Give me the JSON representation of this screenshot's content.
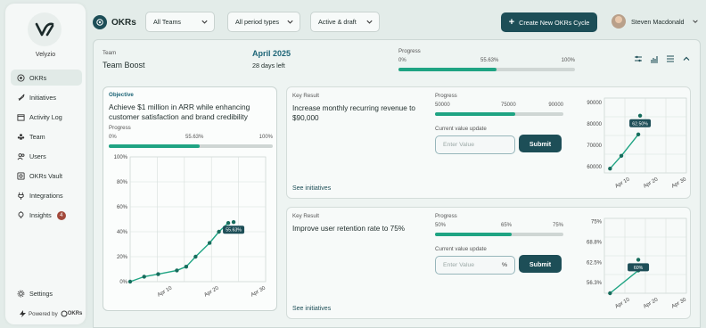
{
  "app": {
    "brand": "Velyzio",
    "powered_by": "Powered by",
    "powered_brand": "OKRs"
  },
  "sidebar": {
    "items": [
      {
        "label": "OKRs",
        "icon": "target-icon",
        "active": true
      },
      {
        "label": "Initiatives",
        "icon": "rocket-icon"
      },
      {
        "label": "Activity Log",
        "icon": "calendar-icon"
      },
      {
        "label": "Team",
        "icon": "team-icon"
      },
      {
        "label": "Users",
        "icon": "users-icon"
      },
      {
        "label": "OKRs Vault",
        "icon": "vault-icon"
      },
      {
        "label": "Integrations",
        "icon": "integrations-icon"
      },
      {
        "label": "Insights",
        "icon": "insights-icon",
        "badge": "4"
      }
    ],
    "settings_label": "Settings"
  },
  "topbar": {
    "title": "OKRs",
    "filters": {
      "team": "All Teams",
      "period": "All period types",
      "status": "Active & draft"
    },
    "create_button": "Create New OKRs Cycle",
    "user_name": "Steven Macdonald"
  },
  "header": {
    "team_label": "Team",
    "team_name": "Team Boost",
    "period_month": "April 2025",
    "days_left": "28 days left",
    "progress_label": "Progress",
    "progress_min": "0%",
    "progress_value_label": "55.63%",
    "progress_max": "100%",
    "progress_fraction": 0.5563
  },
  "objective": {
    "tag": "Objective",
    "title": "Achieve $1 million in ARR while enhancing customer satisfaction and brand credibility",
    "progress_label": "Progress",
    "progress_min": "0%",
    "progress_value_label": "55.63%",
    "progress_max": "100%",
    "progress_fraction": 0.5563
  },
  "key_results": [
    {
      "label": "Key Result",
      "title": "Increase monthly recurring revenue to $90,000",
      "progress_label": "Progress",
      "progress_min": "50000",
      "progress_value_label": "75000",
      "progress_max": "90000",
      "progress_fraction": 0.625,
      "input_label": "Current value update",
      "input_placeholder": "Enter Value",
      "input_suffix": "",
      "submit_label": "Submit",
      "see_initiatives": "See initiatives"
    },
    {
      "label": "Key Result",
      "title": "Improve user retention rate to 75%",
      "progress_label": "Progress",
      "progress_min": "50%",
      "progress_value_label": "65%",
      "progress_max": "75%",
      "progress_fraction": 0.6,
      "input_label": "Current value update",
      "input_placeholder": "Enter Value",
      "input_suffix": "%",
      "submit_label": "Submit",
      "see_initiatives": "See initiatives"
    }
  ],
  "chart_data": [
    {
      "type": "line",
      "x_ticks": [
        "Apr 10",
        "Apr 20",
        "Apr 30"
      ],
      "y_ticks": [
        "0%",
        "20%",
        "40%",
        "60%",
        "80%",
        "100%"
      ],
      "ylim": [
        0,
        100
      ],
      "xlim": [
        1,
        30
      ],
      "x": [
        1,
        4,
        7,
        11,
        13,
        15,
        18,
        20,
        22
      ],
      "y": [
        0,
        4,
        6,
        9,
        12,
        20,
        31,
        40,
        47
      ],
      "annotation": "55.63%"
    },
    {
      "type": "line",
      "x_ticks": [
        "Apr 10",
        "Apr 20",
        "Apr 30"
      ],
      "y_ticks": [
        "60000",
        "70000",
        "80000",
        "90000"
      ],
      "ylim": [
        57000,
        92000
      ],
      "xlim": [
        1,
        30
      ],
      "x": [
        3,
        7,
        13
      ],
      "y": [
        59000,
        65000,
        75000
      ],
      "annotation": "62.50%"
    },
    {
      "type": "line",
      "x_ticks": [
        "Apr 10",
        "Apr 20",
        "Apr 30"
      ],
      "y_ticks": [
        "56.3%",
        "62.5%",
        "68.8%",
        "75%"
      ],
      "ylim": [
        53,
        76
      ],
      "xlim": [
        1,
        30
      ],
      "x": [
        3,
        13
      ],
      "y": [
        53,
        60
      ],
      "annotation": "60%"
    }
  ]
}
